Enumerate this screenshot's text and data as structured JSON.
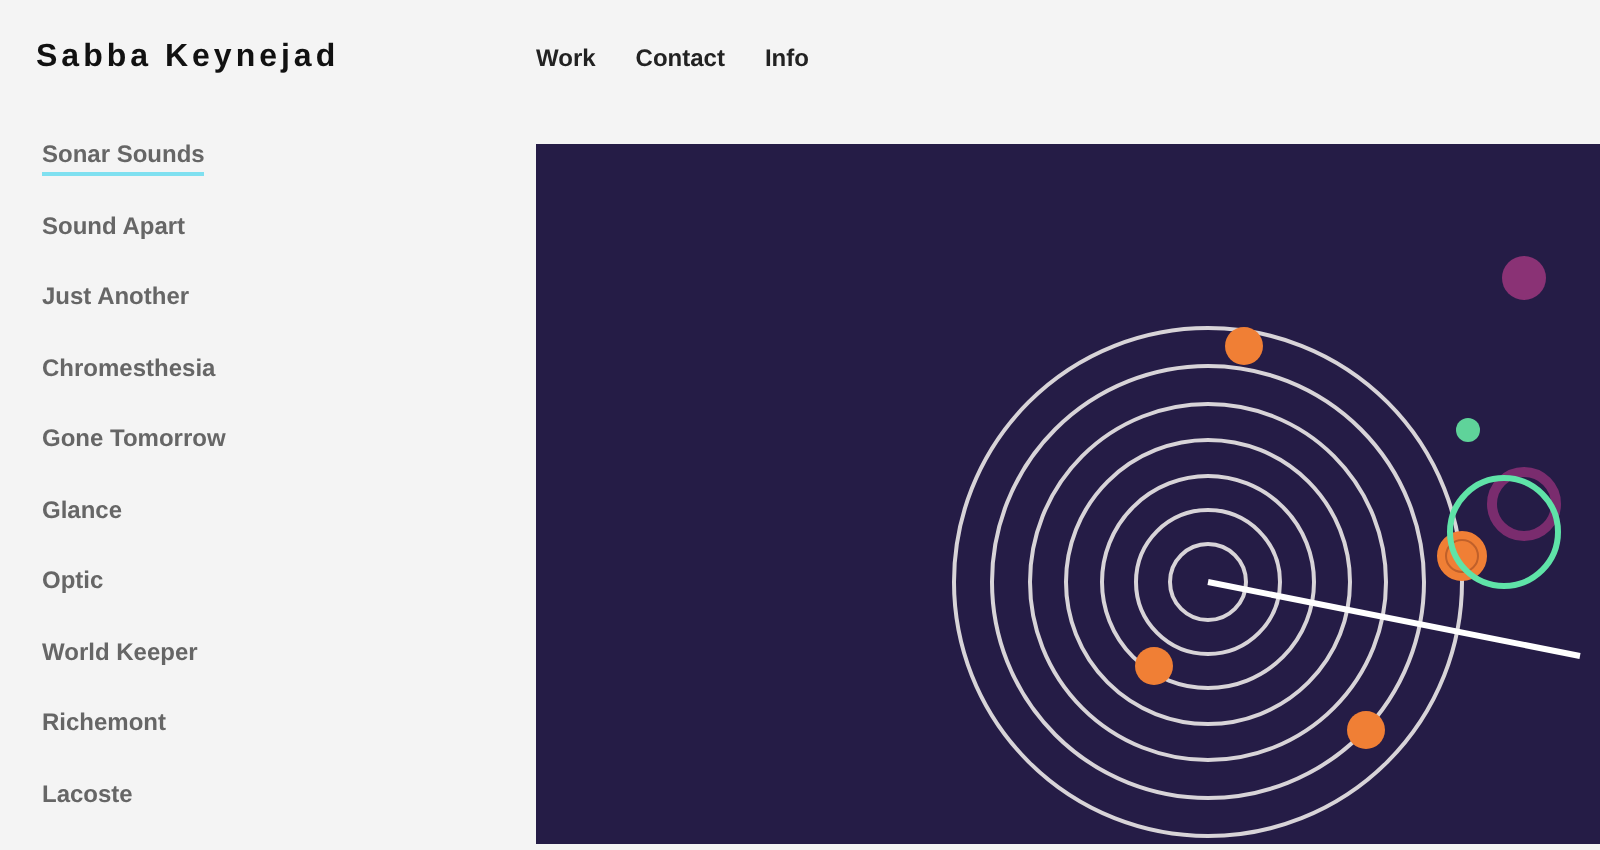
{
  "site_title": "Sabba Keynejad",
  "nav": [
    {
      "label": "Work"
    },
    {
      "label": "Contact"
    },
    {
      "label": "Info"
    }
  ],
  "projects": [
    {
      "label": "Sonar Sounds",
      "selected": true
    },
    {
      "label": "Sound Apart",
      "selected": false
    },
    {
      "label": "Just Another",
      "selected": false
    },
    {
      "label": "Chromesthesia",
      "selected": false
    },
    {
      "label": "Gone Tomorrow",
      "selected": false
    },
    {
      "label": "Glance",
      "selected": false
    },
    {
      "label": "Optic",
      "selected": false
    },
    {
      "label": "World Keeper",
      "selected": false
    },
    {
      "label": "Richemont",
      "selected": false
    },
    {
      "label": "Lacoste",
      "selected": false
    }
  ]
}
